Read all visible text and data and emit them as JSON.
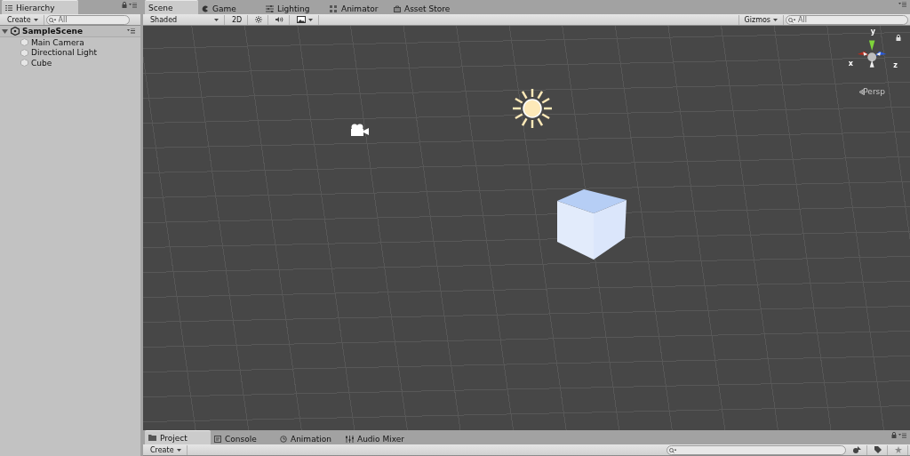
{
  "hierarchy": {
    "tab": {
      "label": "Hierarchy",
      "selected": true
    },
    "create": "Create",
    "search": {
      "placeholder": "All"
    },
    "scene": {
      "name": "SampleScene",
      "expanded": true,
      "children": [
        {
          "name": "Main Camera"
        },
        {
          "name": "Directional Light"
        },
        {
          "name": "Cube"
        }
      ]
    }
  },
  "scene_tabs": [
    {
      "label": "Scene",
      "kind": "scene",
      "selected": true
    },
    {
      "label": "Game",
      "kind": "game",
      "selected": false
    },
    {
      "label": "Lighting",
      "kind": "lighting",
      "selected": false
    },
    {
      "label": "Animator",
      "kind": "animator",
      "selected": false
    },
    {
      "label": "Asset Store",
      "kind": "store",
      "selected": false
    }
  ],
  "scene_toolbar": {
    "shading": "Shaded",
    "mode_2d": "2D",
    "lighting_on": false,
    "audio_on": false,
    "gizmos": "Gizmos",
    "search": {
      "placeholder": "All"
    }
  },
  "gizmo": {
    "y": "y",
    "x": "x",
    "z": "z",
    "projection": "Persp"
  },
  "bottom_tabs": [
    {
      "label": "Project",
      "kind": "project",
      "selected": true
    },
    {
      "label": "Console",
      "kind": "console",
      "selected": false
    },
    {
      "label": "Animation",
      "kind": "animation",
      "selected": false
    },
    {
      "label": "Audio Mixer",
      "kind": "mixer",
      "selected": false
    }
  ],
  "project_toolbar": {
    "create": "Create"
  }
}
